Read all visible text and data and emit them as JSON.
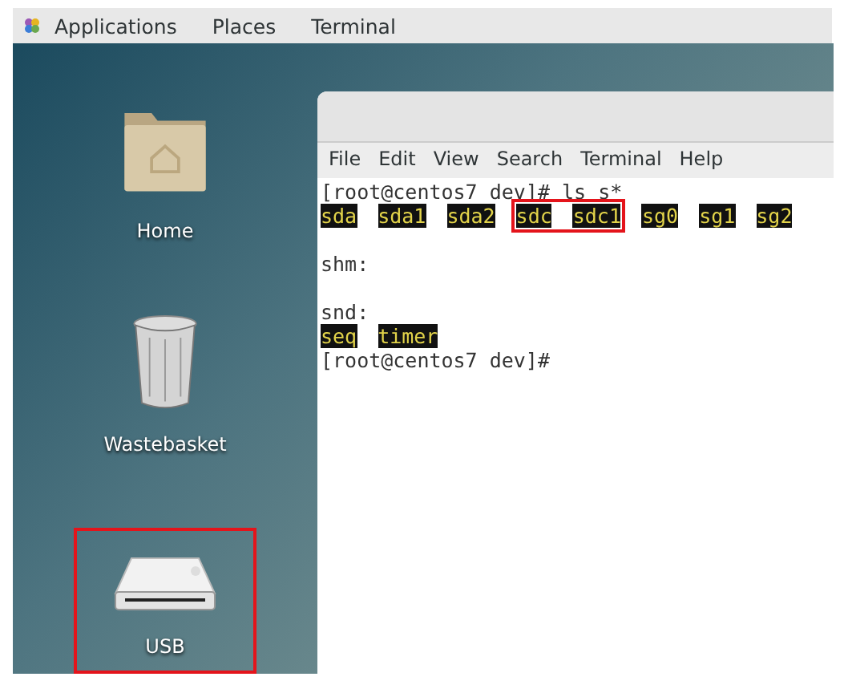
{
  "top_bar": {
    "items": [
      "Applications",
      "Places",
      "Terminal"
    ]
  },
  "desktop_icons": [
    {
      "kind": "folder",
      "label": "Home",
      "highlighted": false
    },
    {
      "kind": "trash",
      "label": "Wastebasket",
      "highlighted": false
    },
    {
      "kind": "drive",
      "label": "USB",
      "highlighted": true
    }
  ],
  "terminal": {
    "menu": [
      "File",
      "Edit",
      "View",
      "Search",
      "Terminal",
      "Help"
    ],
    "lines": [
      {
        "kind": "text",
        "text": "[root@centos7 dev]# ls s*"
      },
      {
        "kind": "files",
        "items": [
          {
            "name": "sda",
            "boxed": false
          },
          {
            "name": "sda1",
            "boxed": false
          },
          {
            "name": "sda2",
            "boxed": false
          },
          {
            "name": "sdc",
            "boxed": true
          },
          {
            "name": "sdc1",
            "boxed": true
          },
          {
            "name": "sg0",
            "boxed": false
          },
          {
            "name": "sg1",
            "boxed": false
          },
          {
            "name": "sg2",
            "boxed": false
          }
        ]
      },
      {
        "kind": "blank"
      },
      {
        "kind": "text",
        "text": "shm:"
      },
      {
        "kind": "blank"
      },
      {
        "kind": "text",
        "text": "snd:"
      },
      {
        "kind": "files",
        "items": [
          {
            "name": "seq",
            "boxed": false
          },
          {
            "name": "timer",
            "boxed": false
          }
        ]
      },
      {
        "kind": "text",
        "text": "[root@centos7 dev]#"
      }
    ]
  }
}
